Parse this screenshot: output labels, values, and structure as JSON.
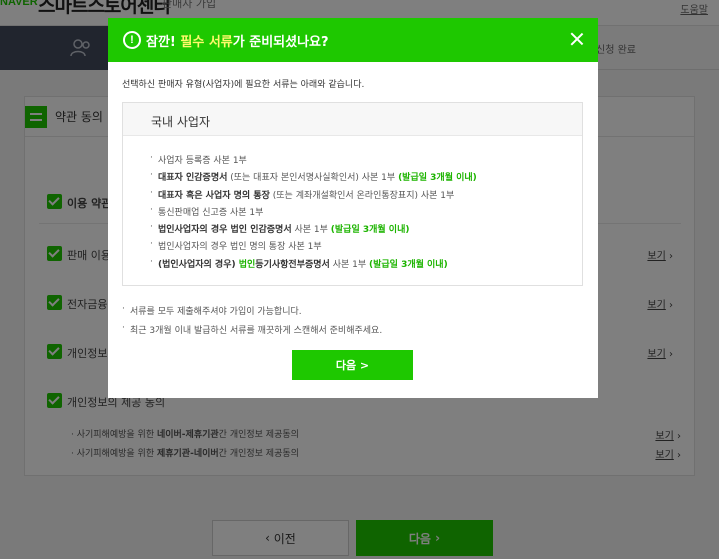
{
  "header": {
    "brand_naver": "NAVER",
    "brand_name": "스마트스토어센터",
    "brand_sub": "판매자 가입",
    "help_link": "도움말"
  },
  "steps": {
    "last_label": "신청 완료"
  },
  "panel": {
    "title": "약관 동의",
    "rows": [
      {
        "label": "이용 약관",
        "view": ""
      },
      {
        "label": "판매 이용",
        "view": "보기"
      },
      {
        "label": "전자금융",
        "view": "보기"
      },
      {
        "label": "개인정보",
        "view": "보기"
      },
      {
        "label": "개인정보의 제공 동의",
        "view": ""
      }
    ],
    "sub_rows": [
      {
        "pre": "· 사기피해예방을 위한 ",
        "strong": "네이버-제휴기관",
        "post": "간 개인정보 제공동의",
        "view": "보기"
      },
      {
        "pre": "· 사기피해예방을 위한 ",
        "strong": "제휴기관-네이버",
        "post": "간 개인정보 제공동의",
        "view": "보기"
      }
    ]
  },
  "footer": {
    "prev_label": "이전",
    "next_label": "다음"
  },
  "modal": {
    "title_pre": "잠깐! ",
    "title_highlight": "필수 서류",
    "title_post": "가 준비되셨나요?",
    "intro": "선택하신 판매자 유형(사업자)에 필요한 서류는 아래와 같습니다.",
    "box_title": "국내 사업자",
    "documents": [
      {
        "parts": [
          {
            "t": "사업자 등록증 사본 1부",
            "s": ""
          }
        ]
      },
      {
        "parts": [
          {
            "t": "대표자 인감증명서",
            "s": "b"
          },
          {
            "t": " (또는 대표자 본인서명사실확인서) 사본 1부 ",
            "s": ""
          },
          {
            "t": "(발급일 3개월 이내)",
            "s": "g"
          }
        ]
      },
      {
        "parts": [
          {
            "t": "대표자 혹은 사업자 명의 통장",
            "s": "b"
          },
          {
            "t": " (또는 계좌개설확인서 온라인통장표지) 사본 1부",
            "s": ""
          }
        ]
      },
      {
        "parts": [
          {
            "t": "통신판매업 신고증 사본 1부",
            "s": ""
          }
        ]
      },
      {
        "parts": [
          {
            "t": "법인사업자의 경우 법인 인감증명서",
            "s": "b"
          },
          {
            "t": " 사본 1부 ",
            "s": ""
          },
          {
            "t": "(발급일 3개월 이내)",
            "s": "g"
          }
        ]
      },
      {
        "parts": [
          {
            "t": "법인사업자의 경우 법인 명의 통장 사본 1부",
            "s": ""
          }
        ]
      },
      {
        "parts": [
          {
            "t": "(법인사업자의 경우) ",
            "s": "b"
          },
          {
            "t": "법인",
            "s": "g"
          },
          {
            "t": "등기사항전부증명서",
            "s": "b"
          },
          {
            "t": " 사본 1부 ",
            "s": ""
          },
          {
            "t": "(발급일 3개월 이내)",
            "s": "g"
          }
        ]
      }
    ],
    "notes": [
      "서류를 모두 제출해주셔야 가입이 가능합니다.",
      "최근 3개월 이내 발급하신 서류를 깨끗하게 스캔해서 준비해주세요."
    ],
    "next_label": "다음 >"
  },
  "colors": {
    "brand_green": "#1ec800",
    "highlight_yellow": "#fff96b"
  }
}
